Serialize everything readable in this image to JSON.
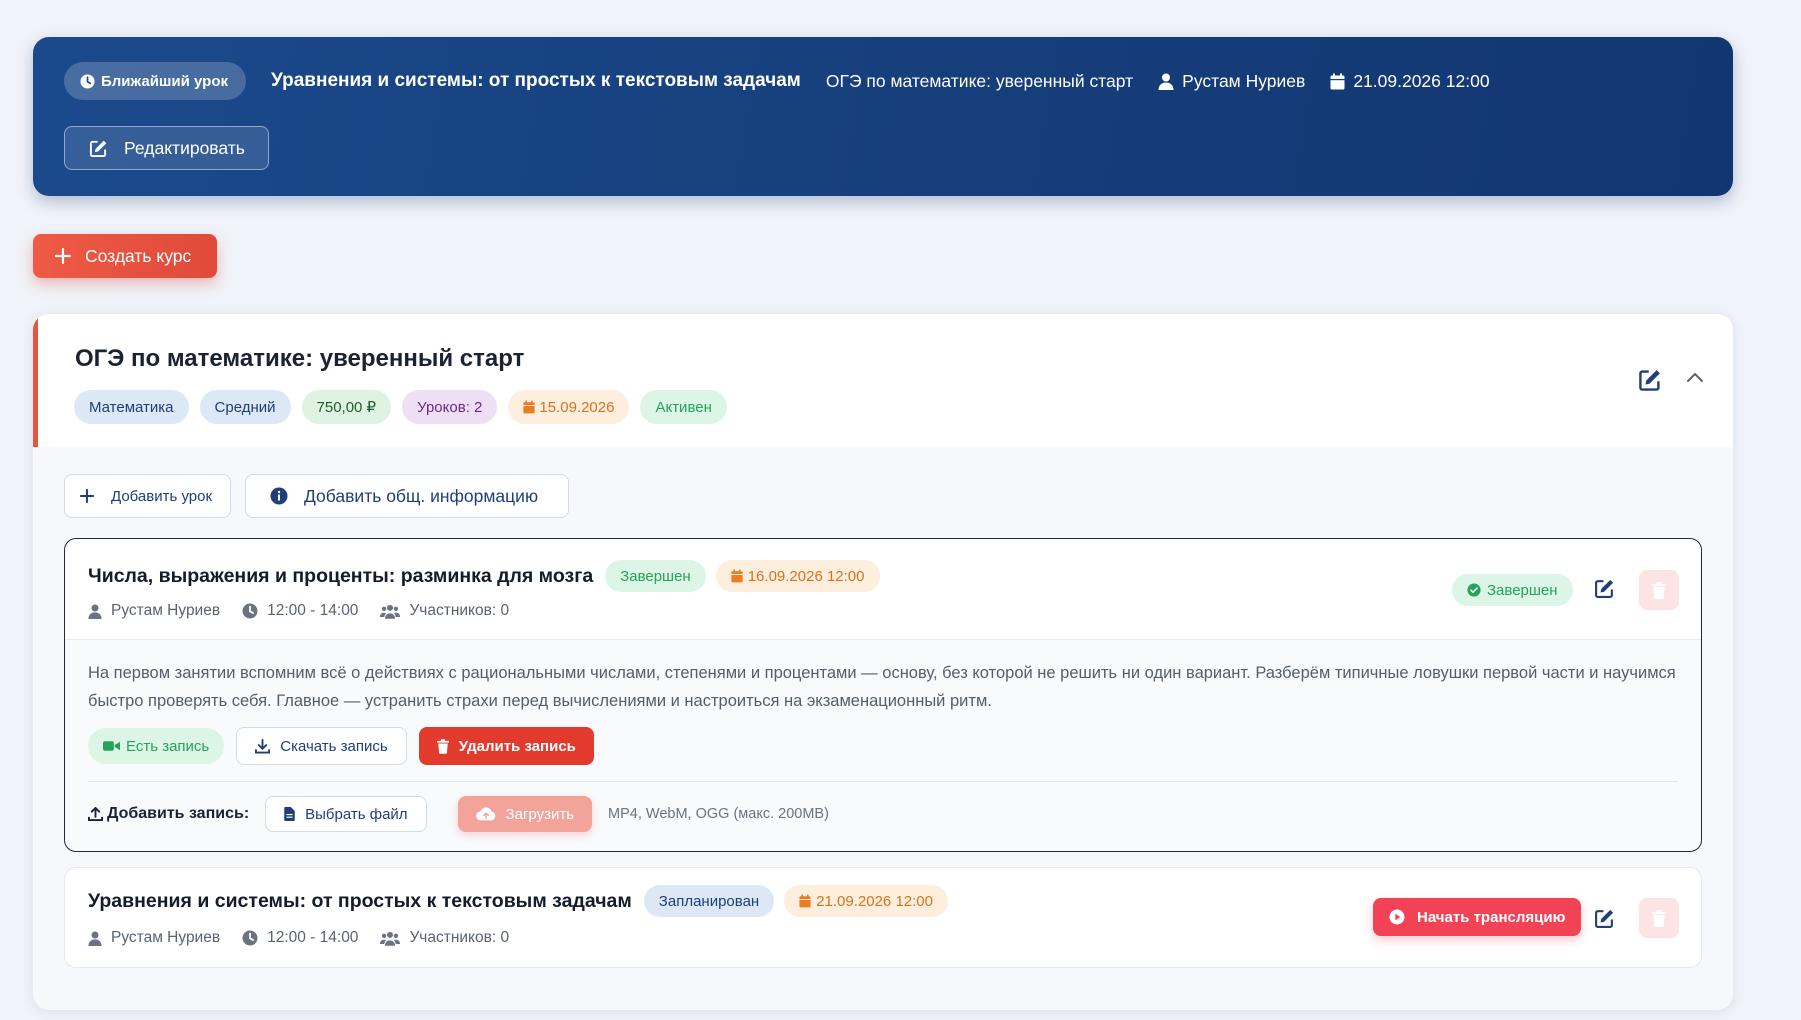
{
  "hero": {
    "badge": "Ближайший урок",
    "title": "Уравнения и системы: от простых к текстовым задачам",
    "course": "ОГЭ по математике: уверенный старт",
    "teacher": "Рустам Нуриев",
    "datetime": "21.09.2026 12:00",
    "edit_label": "Редактировать"
  },
  "create_course_label": "Создать курс",
  "course": {
    "title": "ОГЭ по математике: уверенный старт",
    "tags": {
      "subject": "Математика",
      "level": "Средний",
      "price": "750,00 ₽",
      "lessons": "Уроков: 2",
      "date": "15.09.2026",
      "status": "Активен"
    },
    "add_lesson_label": "Добавить урок",
    "add_info_label": "Добавить общ. информацию"
  },
  "lessons": [
    {
      "title": "Числа, выражения и проценты: разминка для мозга",
      "status": "Завершен",
      "date": "16.09.2026 12:00",
      "teacher": "Рустам Нуриев",
      "time": "12:00 - 14:00",
      "participants": "Участников: 0",
      "status_chip": "Завершен",
      "description": "На первом занятии вспомним всё о действиях с рациональными числами, степенями и процентами — основу, без которой не решить ни один вариант. Разберём типичные ловушки первой части и научимся быстро проверять себя. Главное — устранить страхи перед вычислениями и настроиться на экзаменационный ритм.",
      "has_recording": "Есть запись",
      "download_label": "Скачать запись",
      "delete_recording_label": "Удалить запись",
      "add_recording_label": "Добавить запись:",
      "choose_file_label": "Выбрать файл",
      "upload_label": "Загрузить",
      "upload_hint": "MP4, WebM, OGG (макс. 200MB)"
    },
    {
      "title": "Уравнения и системы: от простых к текстовым задачам",
      "status": "Запланирован",
      "date": "21.09.2026 12:00",
      "teacher": "Рустам Нуриев",
      "time": "12:00 - 14:00",
      "participants": "Участников: 0",
      "stream_label": "Начать трансляцию"
    }
  ],
  "colors": {
    "hero_bg": "#17407e",
    "accent_red": "#e8553f",
    "success": "#26a35a",
    "danger": "#e23a2c",
    "stream": "#f24255",
    "date_orange": "#d9731c"
  }
}
